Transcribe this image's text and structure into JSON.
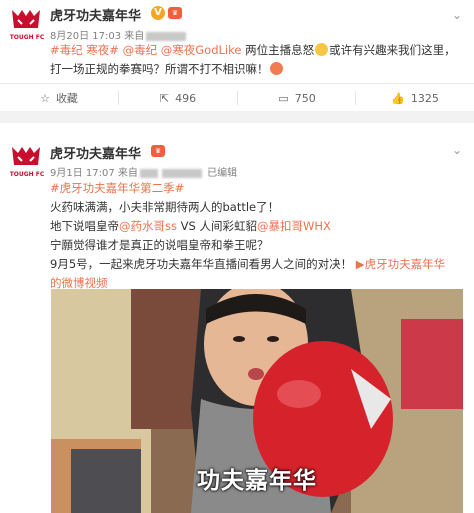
{
  "post1": {
    "author": "虎牙功夫嘉年华",
    "logo_text": "TOUGH FC",
    "verified_icon": "v-badge-icon",
    "vip_icon": "vip-badge-icon",
    "time": "8月20日 17:03 来自",
    "text_parts": [
      "#毒纪 寒夜#",
      " ",
      "@毒纪",
      " ",
      "@寒夜GodLike",
      " 两位主播息怒",
      "或许有兴趣来我们这里，打一场正规的拳赛吗？所谓不打不相识嘛！"
    ],
    "actions": {
      "favorite": "收藏",
      "share": "496",
      "comment": "750",
      "like": "1325"
    }
  },
  "post2": {
    "author": "虎牙功夫嘉年华",
    "logo_text": "TOUGH FC",
    "time": "9月1日 17:07 来自",
    "edited": "已编辑",
    "hashtag": "#虎牙功夫嘉年华第二季#",
    "line1": "火药味满满，小夫非常期待两人的battle了！",
    "line2_a": "地下说唱皇帝",
    "line2_b": "@药水哥ss",
    "line2_c": " VS 人间彩虹貂",
    "line2_d": "@暴扣哥WHX",
    "line3": "宁願觉得谁才是真正的说唱皇帝和拳王呢？",
    "line4": "9月5号，一起来虎牙功夫嘉年华直播间看男人之间的对决！",
    "line4_link": "虎牙功夫嘉年华",
    "line5_link": "的微博视频",
    "video_caption": "功夫嘉年华"
  },
  "colors": {
    "link": "#eb7350",
    "brand_red": "#c8102e",
    "meta_gray": "#808080"
  }
}
